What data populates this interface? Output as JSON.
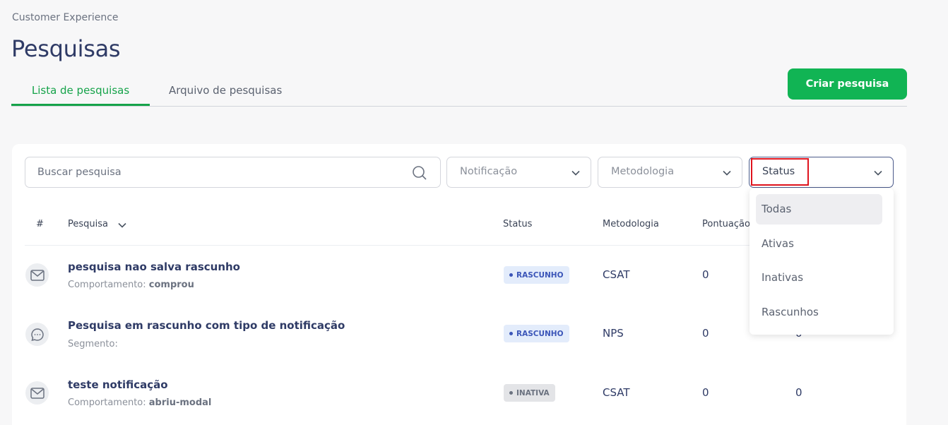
{
  "breadcrumb": "Customer Experience",
  "page_title": "Pesquisas",
  "tabs": [
    {
      "label": "Lista de pesquisas",
      "active": true
    },
    {
      "label": "Arquivo de pesquisas",
      "active": false
    }
  ],
  "create_button": "Criar pesquisa",
  "filters": {
    "search_placeholder": "Buscar pesquisa",
    "notification": "Notificação",
    "methodology": "Metodologia",
    "status": "Status"
  },
  "table": {
    "headers": {
      "hash": "#",
      "survey": "Pesquisa",
      "status": "Status",
      "methodology": "Metodologia",
      "score": "Pontuação"
    },
    "rows": [
      {
        "icon": "mail-icon",
        "title": "pesquisa nao salva rascunho",
        "sub_label": "Comportamento:",
        "sub_value": "comprou",
        "status": "RASCUNHO",
        "methodology": "CSAT",
        "score": "0",
        "extra": "0"
      },
      {
        "icon": "chat-icon",
        "title": "Pesquisa em rascunho com tipo de notificação",
        "sub_label": "Segmento:",
        "sub_value": "",
        "status": "RASCUNHO",
        "methodology": "NPS",
        "score": "0",
        "extra": "0"
      },
      {
        "icon": "mail-icon",
        "title": "teste notificação",
        "sub_label": "Comportamento:",
        "sub_value": "abriu-modal",
        "status": "INATIVA",
        "methodology": "CSAT",
        "score": "0",
        "extra": "0"
      }
    ]
  },
  "status_dropdown": {
    "options": [
      "Todas",
      "Ativas",
      "Inativas",
      "Rascunhos"
    ],
    "selected": "Todas"
  },
  "colors": {
    "accent": "#11b454",
    "title": "#2f3b66",
    "highlight": "#e0141e"
  }
}
